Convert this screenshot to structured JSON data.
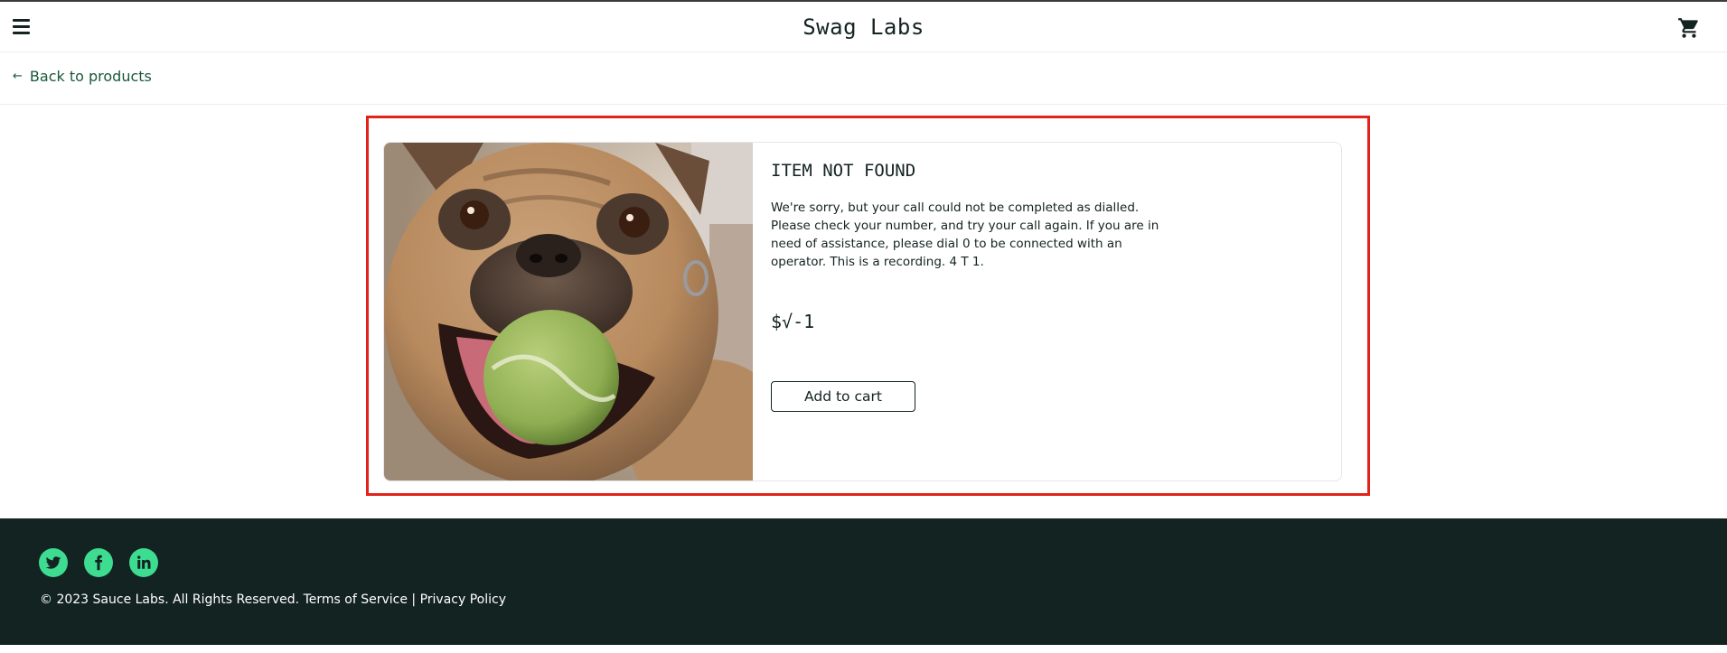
{
  "header": {
    "app_logo": "Swag Labs",
    "menu_icon": "hamburger-menu-icon",
    "cart_icon": "shopping-cart-icon"
  },
  "subheader": {
    "back_arrow": "←",
    "back_label": "Back to products"
  },
  "product": {
    "image_alt": "French bulldog with a tennis ball in its mouth",
    "name": "ITEM NOT FOUND",
    "description": "We're sorry, but your call could not be completed as dialled. Please check your number, and try your call again. If you are in need of assistance, please dial 0 to be connected with an operator. This is a recording. 4 T 1.",
    "price": "$√-1",
    "add_to_cart_label": "Add to cart"
  },
  "footer": {
    "social": [
      "twitter-icon",
      "facebook-icon",
      "linkedin-icon"
    ],
    "copyright": "© 2023 Sauce Labs. All Rights Reserved.",
    "terms_label": "Terms of Service",
    "separator": "|",
    "privacy_label": "Privacy Policy"
  },
  "colors": {
    "highlight_border": "#e2231a",
    "footer_bg": "#132322",
    "social_green": "#3ddc91",
    "link_green": "#18583a"
  }
}
